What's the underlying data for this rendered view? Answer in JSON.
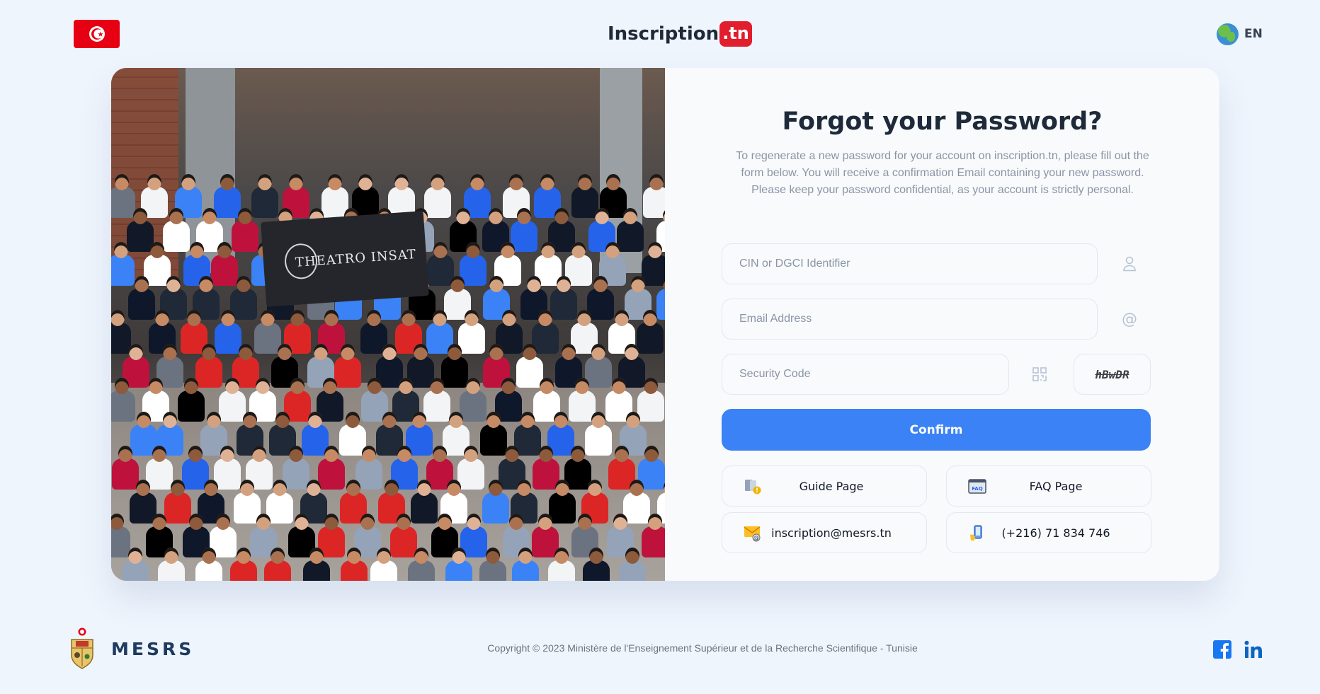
{
  "header": {
    "brand_main": "Inscription",
    "brand_suffix": ".tn",
    "language": "EN"
  },
  "photo": {
    "banner_text": "THEATRO INSAT"
  },
  "form": {
    "title": "Forgot your Password?",
    "description": "To regenerate a new password for your account on inscription.tn, please fill out the form below. You will receive a confirmation Email containing your new password. Please keep your password confidential, as your account is strictly personal.",
    "cin_placeholder": "CIN or DGCI Identifier",
    "email_placeholder": "Email Address",
    "security_placeholder": "Security Code",
    "captcha": "hBwDR",
    "confirm_label": "Confirm"
  },
  "links": {
    "guide": "Guide Page",
    "faq": "FAQ Page",
    "email": "inscription@mesrs.tn",
    "phone": "(+216) 71 834 746"
  },
  "footer": {
    "org": "MESRS",
    "copyright": "Copyright © 2023 Ministère de l'Enseignement Supérieur et de la Recherche Scientifique - Tunisie"
  },
  "colors": {
    "accent": "#3b82f6",
    "brand_red": "#e11d2e",
    "background": "#eff5fd"
  },
  "icons": [
    "tunisia-flag-icon",
    "globe-icon",
    "user-icon",
    "at-icon",
    "qr-icon",
    "guide-icon",
    "faq-icon",
    "mail-icon",
    "phone-icon",
    "facebook-icon",
    "linkedin-icon"
  ]
}
